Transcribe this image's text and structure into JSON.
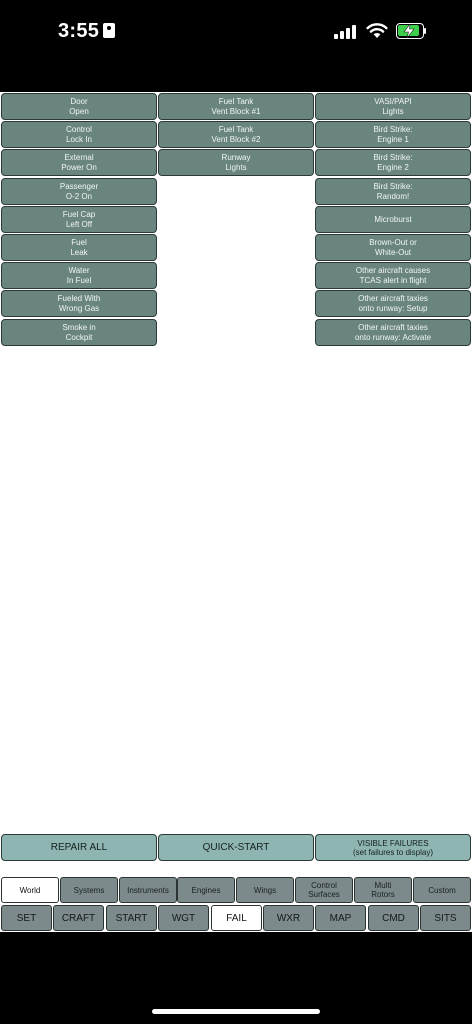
{
  "status": {
    "time": "3:55"
  },
  "colors": {
    "failure_button": "#6a8580",
    "action_button": "#8fb5b2",
    "tab_inactive": "#7c8a8b",
    "tab_active": "#ffffff",
    "battery": "#3ed04d"
  },
  "failures": {
    "col1": [
      {
        "l1": "Door",
        "l2": "Open"
      },
      {
        "l1": "Control",
        "l2": "Lock In"
      },
      {
        "l1": "External",
        "l2": "Power On"
      },
      {
        "l1": "Passenger",
        "l2": "O-2 On"
      },
      {
        "l1": "Fuel Cap",
        "l2": "Left Off"
      },
      {
        "l1": "Fuel",
        "l2": "Leak"
      },
      {
        "l1": "Water",
        "l2": "In Fuel"
      },
      {
        "l1": "Fueled With",
        "l2": "Wrong Gas"
      },
      {
        "l1": "Smoke in",
        "l2": "Cockpit"
      }
    ],
    "col2": [
      {
        "l1": "Fuel Tank",
        "l2": "Vent Block #1"
      },
      {
        "l1": "Fuel Tank",
        "l2": "Vent Block #2"
      },
      {
        "l1": "Runway",
        "l2": "Lights"
      }
    ],
    "col3": [
      {
        "l1": "VASI/PAPI",
        "l2": "Lights"
      },
      {
        "l1": "Bird Strike:",
        "l2": "Engine 1"
      },
      {
        "l1": "Bird Strike:",
        "l2": "Engine 2"
      },
      {
        "l1": "Bird Strike:",
        "l2": "Random!"
      },
      {
        "l1": "Microburst",
        "l2": ""
      },
      {
        "l1": "Brown-Out or",
        "l2": "White-Out"
      },
      {
        "l1": "Other aircraft causes",
        "l2": "TCAS alert in flight"
      },
      {
        "l1": "Other aircraft taxies",
        "l2": "onto runway: Setup"
      },
      {
        "l1": "Other aircraft taxies",
        "l2": "onto runway: Activate"
      }
    ]
  },
  "actions": {
    "repair_all": "REPAIR ALL",
    "quick_start": "QUICK-START",
    "visible_failures_l1": "VISIBLE FAILURES",
    "visible_failures_l2": "(set failures to display)"
  },
  "categories": [
    {
      "l1": "World",
      "l2": "",
      "active": true
    },
    {
      "l1": "Systems",
      "l2": ""
    },
    {
      "l1": "Instruments",
      "l2": ""
    },
    {
      "l1": "Engines",
      "l2": ""
    },
    {
      "l1": "Wings",
      "l2": ""
    },
    {
      "l1": "Control",
      "l2": "Surfaces"
    },
    {
      "l1": "Multi",
      "l2": "Rotors"
    },
    {
      "l1": "Custom",
      "l2": ""
    }
  ],
  "modes": [
    "SET",
    "CRAFT",
    "START",
    "WGT",
    "FAIL",
    "WXR",
    "MAP",
    "CMD",
    "SITS"
  ],
  "active_mode": "FAIL"
}
